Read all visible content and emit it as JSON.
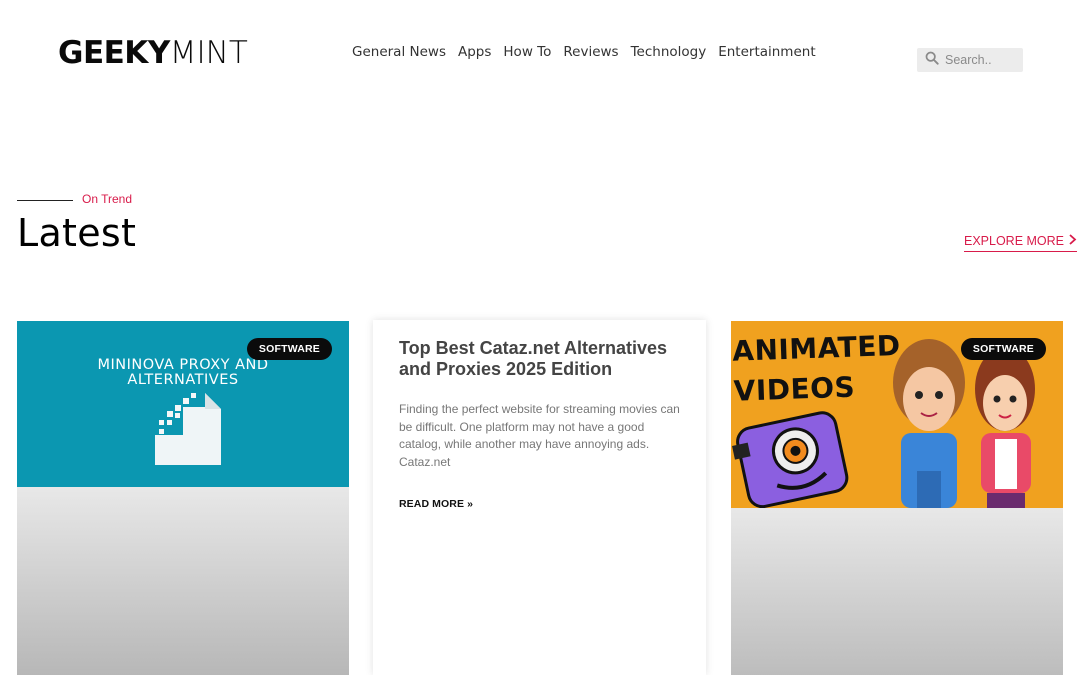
{
  "header": {
    "logo_bold": "GEEKY",
    "logo_light": "MINT",
    "nav": [
      "General News",
      "Apps",
      "How To",
      "Reviews",
      "Technology",
      "Entertainment"
    ],
    "search_placeholder": "Search.."
  },
  "section": {
    "eyebrow": "On Trend",
    "title": "Latest",
    "explore_label": "EXPLORE MORE"
  },
  "cards": [
    {
      "badge": "SOFTWARE",
      "image_line1": "MININOVA PROXY AND",
      "image_line2": "ALTERNATIVES"
    },
    {
      "title": "Top Best Cataz.net Alternatives and Proxies 2025 Edition",
      "excerpt": "Finding the perfect website for streaming movies can be difficult. One platform may not have a good catalog, while another may have annoying ads. Cataz.net",
      "read_more": "READ MORE »"
    },
    {
      "badge": "SOFTWARE",
      "image_text": "ANIMATED VIDEOS"
    }
  ],
  "colors": {
    "accent": "#d81b4a",
    "card1_bg": "#0b97b1",
    "card3_bg": "#f0a11f"
  }
}
